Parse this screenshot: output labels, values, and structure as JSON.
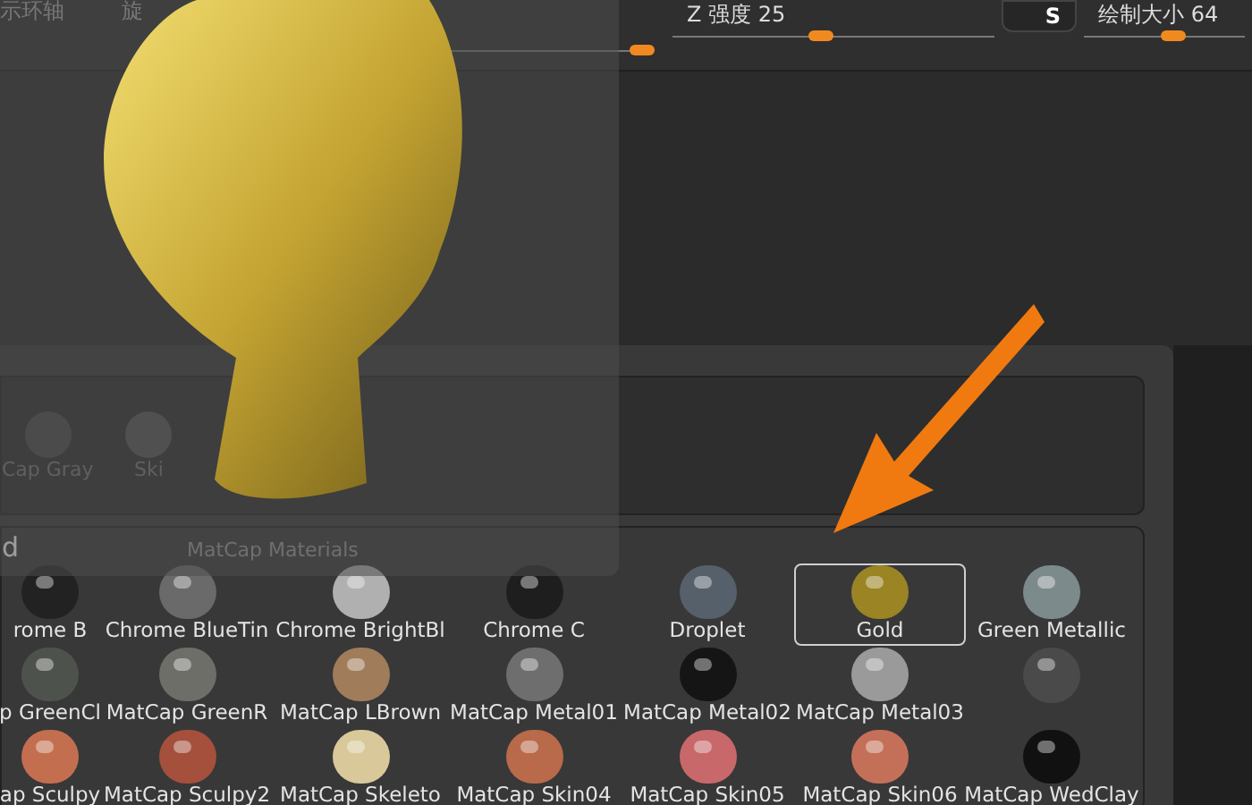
{
  "top_bar": {
    "labels": [
      "示环轴",
      "旋"
    ],
    "sliders": [
      {
        "level": 0.95
      },
      {
        "label": "Z 强度",
        "value": "25",
        "level": 0.46
      },
      {
        "label": "绘制大小",
        "value": "64",
        "level": 0.55
      }
    ],
    "s_button": "S"
  },
  "preview": {
    "title": "MatCap Materials"
  },
  "quick_materials": [
    {
      "label": "Cap Gray",
      "color": "#4a4a4a"
    },
    {
      "label": "Ski",
      "color": "#555555"
    }
  ],
  "palette": {
    "heading": "d",
    "rows": [
      [
        {
          "label": "rome B",
          "color": "#222222",
          "selected": false
        },
        {
          "label": "Chrome BlueTin",
          "color": "#6a6a6a",
          "selected": false
        },
        {
          "label": "Chrome BrightBl",
          "color": "#b0b0b0",
          "selected": false
        },
        {
          "label": "Chrome C",
          "color": "#1e1e1e",
          "selected": false
        },
        {
          "label": "Droplet",
          "color": "#56606a",
          "selected": false
        },
        {
          "label": "Gold",
          "color": "#9a8424",
          "selected": true
        },
        {
          "label": "Green Metallic",
          "color": "#7d8a8c",
          "selected": false
        }
      ],
      [
        {
          "label": "p GreenCl",
          "color": "#4e524c",
          "selected": false
        },
        {
          "label": "MatCap GreenR",
          "color": "#6e6e68",
          "selected": false
        },
        {
          "label": "MatCap LBrown",
          "color": "#a07c5a",
          "selected": false
        },
        {
          "label": "MatCap Metal01",
          "color": "#6e6e6e",
          "selected": false
        },
        {
          "label": "MatCap Metal02",
          "color": "#151515",
          "selected": false
        },
        {
          "label": "MatCap Metal03",
          "color": "#9a9a9a",
          "selected": false
        },
        {
          "color": "#4a4a4a",
          "selected": false
        }
      ],
      [
        {
          "label": "ap Sculpy",
          "color": "#c46e50",
          "selected": false
        },
        {
          "label": "MatCap Sculpy2",
          "color": "#a4503c",
          "selected": false
        },
        {
          "label": "MatCap Skeleto",
          "color": "#d8c89a",
          "selected": false
        },
        {
          "label": "MatCap Skin04",
          "color": "#b86a4a",
          "selected": false
        },
        {
          "label": "MatCap Skin05",
          "color": "#c8686a",
          "selected": false
        },
        {
          "label": "MatCap Skin06",
          "color": "#c47058",
          "selected": false
        },
        {
          "label": "MatCap WedClay",
          "color": "#111111",
          "selected": false
        }
      ]
    ]
  }
}
